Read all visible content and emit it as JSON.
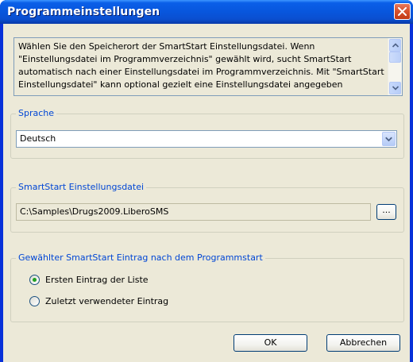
{
  "window": {
    "title": "Programmeinstellungen"
  },
  "info": {
    "text": "Wählen Sie den Speicherort der SmartStart Einstellungsdatei. Wenn\n\"Einstellungsdatei im Programmverzeichnis\" gewählt wird, sucht SmartStart\nautomatisch nach einer Einstellungsdatei im Programmverzeichnis. Mit \"SmartStart\nEinstellungsdatei\" kann optional gezielt eine Einstellungsdatei angegeben"
  },
  "language": {
    "legend": "Sprache",
    "selected": "Deutsch"
  },
  "settings_file": {
    "legend": "SmartStart Einstellungsdatei",
    "path": "C:\\Samples\\Drugs2009.LiberoSMS",
    "browse_label": "..."
  },
  "startup_entry": {
    "legend": "Gewählter SmartStart Eintrag nach dem Programmstart",
    "options": [
      {
        "label": "Ersten Eintrag der Liste",
        "selected": true
      },
      {
        "label": "Zuletzt verwendeter Eintrag",
        "selected": false
      }
    ]
  },
  "buttons": {
    "ok": "OK",
    "cancel": "Abbrechen"
  },
  "colors": {
    "titlebar": "#0a5fe8",
    "legend_text": "#0046d5",
    "close_button": "#d8532f",
    "radio_dot": "#21a121",
    "dialog_bg": "#ece9d8"
  },
  "icons": {
    "close": "close-icon",
    "scroll_up": "chevron-up-icon",
    "scroll_down": "chevron-down-icon",
    "dropdown": "chevron-down-icon"
  }
}
